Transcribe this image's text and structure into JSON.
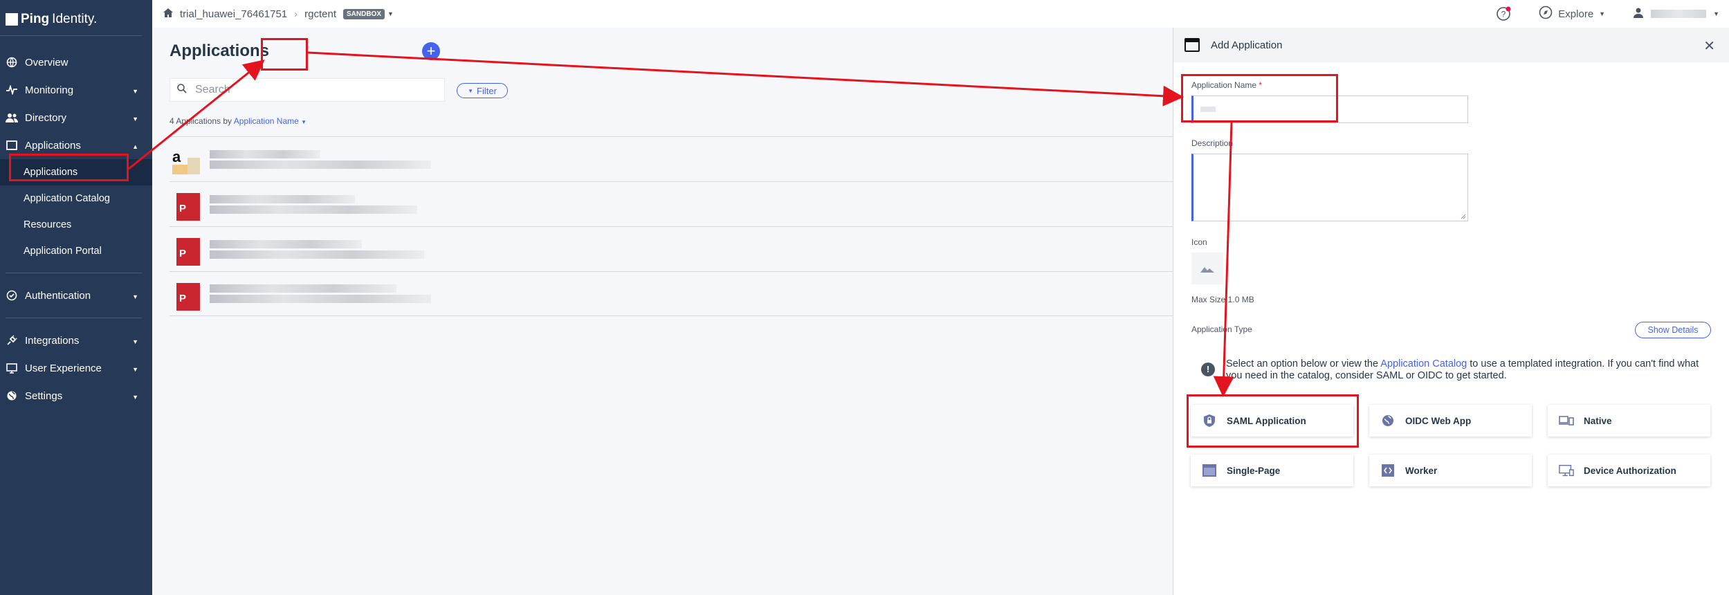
{
  "brand": {
    "name_bold": "Ping",
    "name_light": "Identity."
  },
  "breadcrumb": {
    "org": "trial_huawei_76461751",
    "environment": "rgctent",
    "badge": "SANDBOX"
  },
  "topbar": {
    "explore_label": "Explore"
  },
  "sidebar": {
    "items": [
      {
        "label": "Overview"
      },
      {
        "label": "Monitoring"
      },
      {
        "label": "Directory"
      },
      {
        "label": "Applications"
      }
    ],
    "sub_items": [
      {
        "label": "Applications"
      },
      {
        "label": "Application Catalog"
      },
      {
        "label": "Resources"
      },
      {
        "label": "Application Portal"
      }
    ],
    "lower_items": [
      {
        "label": "Authentication"
      },
      {
        "label": "Integrations"
      },
      {
        "label": "User Experience"
      },
      {
        "label": "Settings"
      }
    ]
  },
  "main": {
    "title": "Applications",
    "add_symbol": "+",
    "search_placeholder": "Search",
    "filter_label": "Filter",
    "count_prefix": "4 Applications by",
    "sort_field": "Application Name"
  },
  "panel": {
    "title": "Add Application",
    "name_label": "Application Name",
    "required_mark": "*",
    "description_label": "Description",
    "icon_label": "Icon",
    "max_size": "Max Size 1.0 MB",
    "type_label": "Application Type",
    "show_details": "Show Details",
    "info_prefix": "Select an option below or view the",
    "info_link": "Application Catalog",
    "info_suffix": "to use a templated integration. If you can't find what you need in the catalog, consider SAML or OIDC to get started.",
    "types": [
      {
        "label": "SAML Application",
        "icon": "lock-shield-icon"
      },
      {
        "label": "OIDC Web App",
        "icon": "globe-icon"
      },
      {
        "label": "Native",
        "icon": "devices-icon"
      },
      {
        "label": "Single-Page",
        "icon": "browser-window-icon"
      },
      {
        "label": "Worker",
        "icon": "code-icon"
      },
      {
        "label": "Device Authorization",
        "icon": "monitor-device-icon"
      }
    ]
  },
  "colors": {
    "sidebar_bg": "#263956",
    "accent": "#4462ed",
    "annotation_red": "#e3141e"
  }
}
